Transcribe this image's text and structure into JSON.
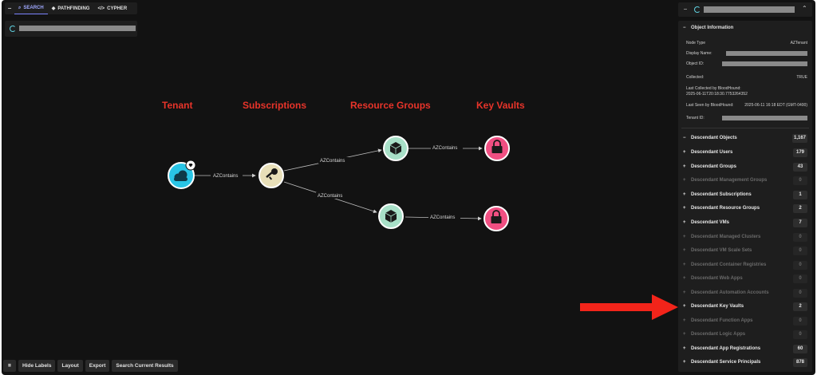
{
  "nav": {
    "collapse_symbol": "−",
    "tabs": [
      {
        "label": "SEARCH",
        "icon": "search-icon",
        "glyph": "⌕"
      },
      {
        "label": "PATHFINDING",
        "icon": "pathfinding-icon",
        "glyph": "◆"
      },
      {
        "label": "CYPHER",
        "icon": "code-icon",
        "glyph": "</>"
      }
    ]
  },
  "graph": {
    "headings": [
      "Tenant",
      "Subscriptions",
      "Resource Groups",
      "Key Vaults"
    ],
    "edge_label": "AZContains",
    "node_colors": {
      "tenant": "#29c5e6",
      "subscription": "#e8dfb8",
      "resource_group": "#a8e0c8",
      "key_vault": "#f04f82"
    }
  },
  "annotation": {
    "arrow_color": "#f2241a"
  },
  "toolbar": {
    "icon": "crop-icon",
    "buttons": [
      "Hide Labels",
      "Layout",
      "Export",
      "Search Current Results"
    ]
  },
  "panel": {
    "object_info_title": "Object Information",
    "node_type_label": "Node Type",
    "node_type_value": "AZTenant",
    "display_name_label": "Display Name:",
    "object_id_label": "Object ID:",
    "collected_label": "Collected:",
    "collected_value": "TRUE",
    "last_collected_label": "Last Collected by BloodHound:",
    "last_collected_value": "2025-06-11T20:18:30.7753264352",
    "last_seen_label": "Last Seen by BloodHound:",
    "last_seen_value": "2025-06-11 16:18 EDT (GMT-0400)",
    "tenant_id_label": "Tenant ID:",
    "descendant_objects_label": "Descendant Objects",
    "descendant_objects_count": "1,167",
    "descendants": [
      {
        "label": "Descendant Users",
        "count": "179",
        "enabled": true
      },
      {
        "label": "Descendant Groups",
        "count": "43",
        "enabled": true
      },
      {
        "label": "Descendant Management Groups",
        "count": "0",
        "enabled": false
      },
      {
        "label": "Descendant Subscriptions",
        "count": "1",
        "enabled": true
      },
      {
        "label": "Descendant Resource Groups",
        "count": "2",
        "enabled": true
      },
      {
        "label": "Descendant VMs",
        "count": "7",
        "enabled": true
      },
      {
        "label": "Descendant Managed Clusters",
        "count": "0",
        "enabled": false
      },
      {
        "label": "Descendant VM Scale Sets",
        "count": "0",
        "enabled": false
      },
      {
        "label": "Descendant Container Registries",
        "count": "0",
        "enabled": false
      },
      {
        "label": "Descendant Web Apps",
        "count": "0",
        "enabled": false
      },
      {
        "label": "Descendant Automation Accounts",
        "count": "0",
        "enabled": false
      },
      {
        "label": "Descendant Key Vaults",
        "count": "2",
        "enabled": true
      },
      {
        "label": "Descendant Function Apps",
        "count": "0",
        "enabled": false
      },
      {
        "label": "Descendant Logic Apps",
        "count": "0",
        "enabled": false
      },
      {
        "label": "Descendant App Registrations",
        "count": "60",
        "enabled": true
      },
      {
        "label": "Descendant Service Principals",
        "count": "878",
        "enabled": true
      }
    ]
  }
}
